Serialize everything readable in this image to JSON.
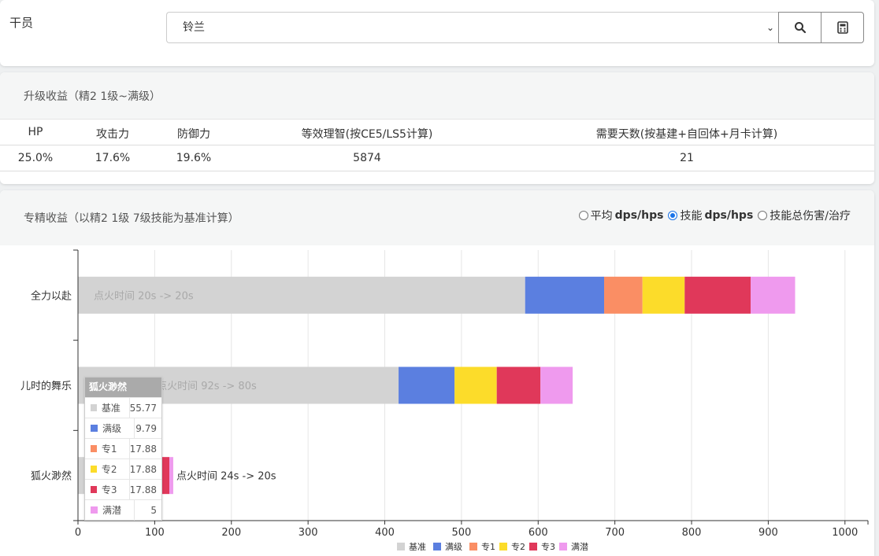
{
  "operator": {
    "label": "干员",
    "selected": "铃兰",
    "search_icon": "search-icon",
    "calc_icon": "calculator-icon"
  },
  "upgrade": {
    "title": "升级收益（精2 1级~满级）",
    "headers": [
      "HP",
      "攻击力",
      "防御力",
      "等效理智(按CE5/LS5计算)",
      "需要天数(按基建+自回体+月卡计算)"
    ],
    "values": [
      "25.0%",
      "17.6%",
      "19.6%",
      "5874",
      "21"
    ]
  },
  "mastery": {
    "title": "专精收益（以精2 1级 7级技能为基准计算）",
    "radios": [
      {
        "label": "平均",
        "bold": "dps/hps",
        "checked": false
      },
      {
        "label": "技能",
        "bold": "dps/hps",
        "checked": true
      },
      {
        "label": "技能总伤害/治疗",
        "bold": "",
        "checked": false
      }
    ]
  },
  "chart_data": {
    "type": "bar",
    "orientation": "horizontal",
    "stacked": true,
    "categories": [
      "全力以赴",
      "儿时的舞乐",
      "狐火渺然"
    ],
    "series": [
      {
        "name": "基准",
        "color": "#d3d3d3",
        "values": [
          583,
          418,
          55.77
        ]
      },
      {
        "name": "满级",
        "color": "#5b7fe0",
        "values": [
          103,
          73,
          9.79
        ]
      },
      {
        "name": "专1",
        "color": "#fa8e64",
        "values": [
          50,
          0,
          17.88
        ]
      },
      {
        "name": "专2",
        "color": "#fcdc2a",
        "values": [
          55,
          55,
          17.88
        ]
      },
      {
        "name": "专3",
        "color": "#e0385a",
        "values": [
          86,
          57,
          17.88
        ]
      },
      {
        "name": "满潜",
        "color": "#ef9aee",
        "values": [
          58,
          42,
          5
        ]
      }
    ],
    "bar_labels": [
      "点火时间 20s -> 20s",
      "(记为1800s) 点火时间 92s -> 80s",
      "点火时间 24s -> 20s"
    ],
    "xlim": [
      0,
      1030
    ],
    "xticks": [
      0,
      100,
      200,
      300,
      400,
      500,
      600,
      700,
      800,
      900,
      1000
    ],
    "grid": true,
    "legend": "bottom-center"
  },
  "tooltip": {
    "title": "狐火渺然",
    "rows": [
      {
        "name": "基准",
        "value": "55.77",
        "color": "#d3d3d3"
      },
      {
        "name": "满级",
        "value": "9.79",
        "color": "#5b7fe0"
      },
      {
        "name": "专1",
        "value": "17.88",
        "color": "#fa8e64"
      },
      {
        "name": "专2",
        "value": "17.88",
        "color": "#fcdc2a"
      },
      {
        "name": "专3",
        "value": "17.88",
        "color": "#e0385a"
      },
      {
        "name": "满潜",
        "value": "5",
        "color": "#ef9aee"
      }
    ]
  }
}
